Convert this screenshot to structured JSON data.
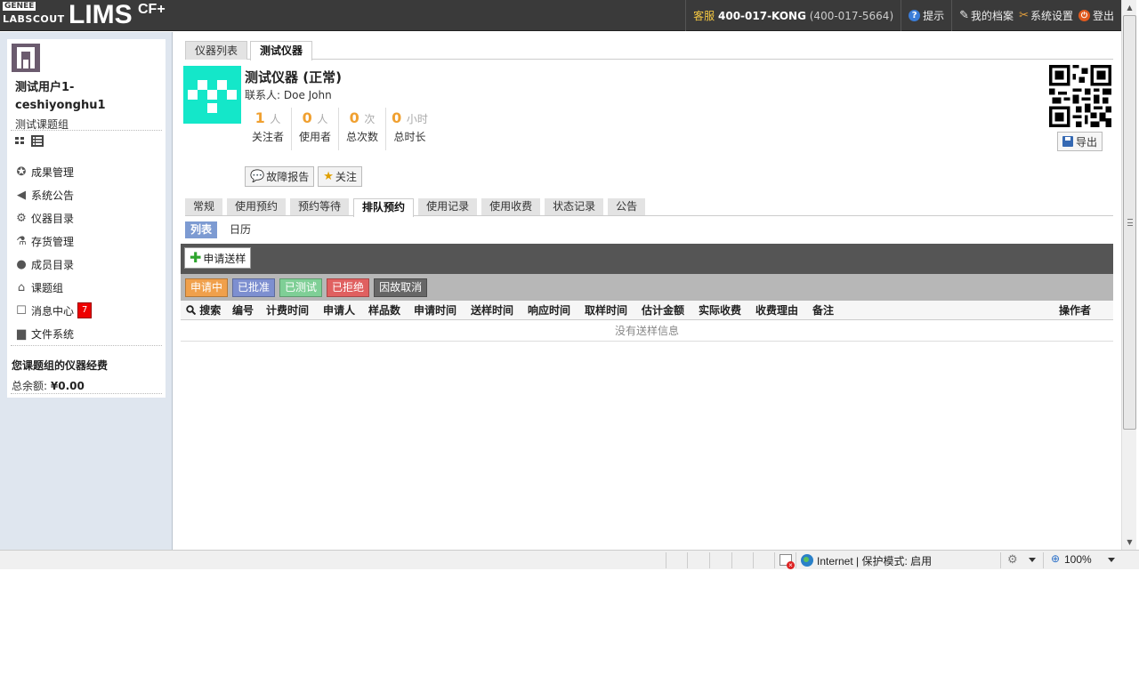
{
  "header": {
    "logo_small_top": "GENEE",
    "logo_small_bottom": "LABSCOUT",
    "logo_big": "LIMS",
    "logo_sup": "CF+",
    "service_label": "客服",
    "service_phone": "400-017-KONG",
    "service_phone_num": "(400-017-5664)",
    "hint": "提示",
    "my_profile": "我的档案",
    "settings": "系统设置",
    "logout": "登出"
  },
  "sidebar": {
    "user_name": "测试用户1-ceshiyonghu1",
    "user_group": "测试课题组",
    "nav": [
      {
        "label": "成果管理",
        "icon": "award-icon"
      },
      {
        "label": "系统公告",
        "icon": "megaphone-icon"
      },
      {
        "label": "仪器目录",
        "icon": "gear-icon"
      },
      {
        "label": "存货管理",
        "icon": "flask-icon"
      },
      {
        "label": "成员目录",
        "icon": "person-icon"
      },
      {
        "label": "课题组",
        "icon": "home-icon"
      },
      {
        "label": "消息中心",
        "icon": "message-icon",
        "badge": "7"
      },
      {
        "label": "文件系统",
        "icon": "folder-icon"
      }
    ],
    "fee_title": "您课题组的仪器经费",
    "fee_balance_label": "总余额:",
    "fee_balance_value": "¥0.00"
  },
  "main": {
    "top_tabs": [
      "仪器列表",
      "测试仪器"
    ],
    "instrument": {
      "title": "测试仪器 (正常)",
      "contact": "联系人: Doe John",
      "stats": [
        {
          "value": "1",
          "unit": "人",
          "label": "关注者"
        },
        {
          "value": "0",
          "unit": "人",
          "label": "使用者"
        },
        {
          "value": "0",
          "unit": "次",
          "label": "总次数"
        },
        {
          "value": "0",
          "unit": "小时",
          "label": "总时长"
        }
      ]
    },
    "export_label": "导出",
    "action_buttons": [
      "故障报告",
      "关注"
    ],
    "detail_tabs": [
      "常规",
      "使用预约",
      "预约等待",
      "排队预约",
      "使用记录",
      "使用收费",
      "状态记录",
      "公告"
    ],
    "sub_tabs": [
      "列表",
      "日历"
    ],
    "apply_button": "申请送样",
    "filters": [
      {
        "label": "申请中",
        "color": "#f0a04b"
      },
      {
        "label": "已批准",
        "color": "#7d8fd0"
      },
      {
        "label": "已测试",
        "color": "#7fcf96"
      },
      {
        "label": "已拒绝",
        "color": "#e06060"
      },
      {
        "label": "因故取消",
        "color": "#666666"
      }
    ],
    "table_headers": [
      "搜索",
      "编号",
      "计费时间",
      "申请人",
      "样品数",
      "申请时间",
      "送样时间",
      "响应时间",
      "取样时间",
      "估计金额",
      "实际收费",
      "收费理由",
      "备注",
      "操作者"
    ],
    "empty_text": "没有送样信息"
  },
  "statusbar": {
    "zone": "Internet | 保护模式: 启用",
    "zoom": "100%"
  }
}
